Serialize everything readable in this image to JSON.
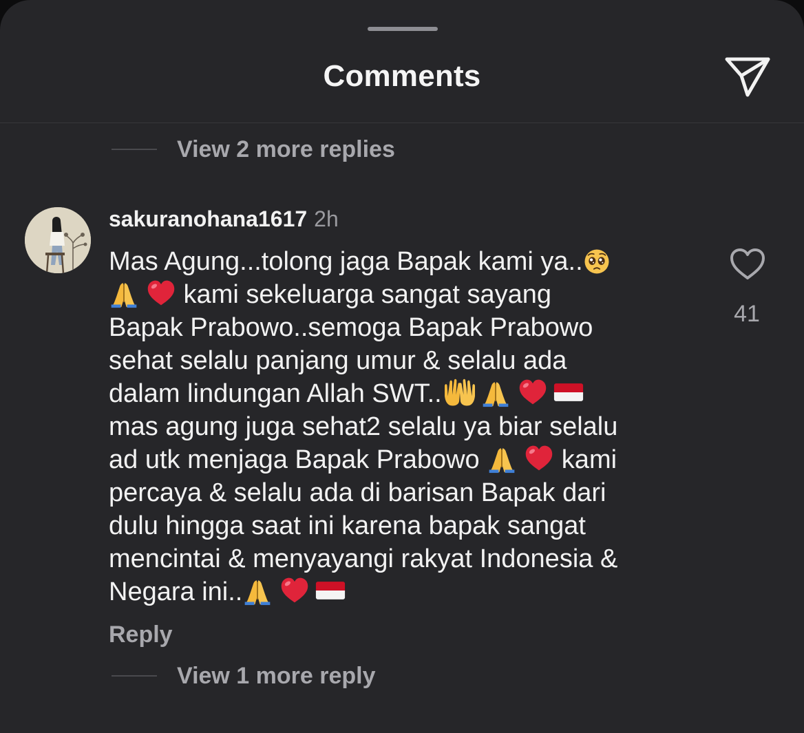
{
  "header": {
    "title": "Comments"
  },
  "thread": {
    "view_more_top": "View 2 more replies",
    "view_more_bottom": "View 1 more reply"
  },
  "comment": {
    "username": "sakuranohana1617",
    "time": "2h",
    "text_lines": [
      "Mas Agung...tolong jaga Bapak kami ya..",
      " kami sekeluarga sangat sayang",
      "Bapak Prabowo..semoga Bapak Prabowo",
      "sehat selalu panjang umur & selalu ada",
      "dalam lindungan Allah SWT..",
      "mas agung juga sehat2 selalu ya biar selalu",
      "ad utk menjaga Bapak Prabowo ",
      " kami",
      "percaya & selalu ada di barisan Bapak dari",
      "dulu hingga saat ini karena bapak sangat",
      "mencintai & menyayangi rakyat Indonesia &",
      "Negara ini.."
    ],
    "emojis": [
      "pleading-face-emoji",
      "folded-hands-emoji",
      "red-heart-emoji",
      "palms-up-emoji",
      "indonesia-flag-emoji"
    ],
    "like_count": "41",
    "reply_label": "Reply"
  },
  "icons": {
    "share": "paper-plane-icon",
    "like": "heart-outline-icon",
    "avatar": "avatar-woman-illustration"
  },
  "colors": {
    "sheet_background": "#262629",
    "primary_text": "#f2f2f2",
    "secondary_text": "#a8a8ad",
    "heart_red": "#e0243a",
    "flag_red": "#ce1126"
  }
}
